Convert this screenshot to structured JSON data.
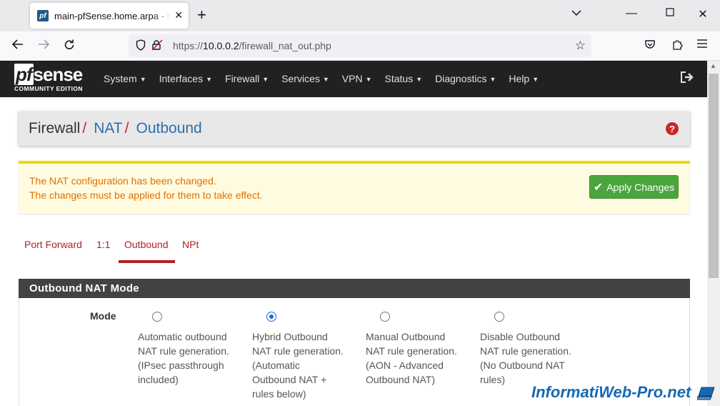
{
  "browser": {
    "tab_title": "main-pfSense.home.arpa - Fire",
    "favicon_text": "pf",
    "url_prefix": "https://",
    "url_host": "10.0.0.2",
    "url_path": "/firewall_nat_out.php"
  },
  "pfsense": {
    "logo_main_pf": "pf",
    "logo_main_rest": "sense",
    "logo_sub": "COMMUNITY EDITION",
    "menu": [
      "System",
      "Interfaces",
      "Firewall",
      "Services",
      "VPN",
      "Status",
      "Diagnostics",
      "Help"
    ]
  },
  "breadcrumb": {
    "root": "Firewall",
    "sep": "/",
    "level1": "NAT",
    "level2": "Outbound"
  },
  "help_icon_glyph": "?",
  "alert": {
    "line1": "The NAT configuration has been changed.",
    "line2": "The changes must be applied for them to take effect.",
    "apply_label": "Apply Changes"
  },
  "subtabs": [
    "Port Forward",
    "1:1",
    "Outbound",
    "NPt"
  ],
  "active_subtab": "Outbound",
  "section": {
    "title": "Outbound NAT Mode",
    "mode_label": "Mode",
    "options": [
      {
        "lines": [
          "Automatic outbound",
          "NAT rule generation.",
          "(IPsec passthrough",
          "included)"
        ],
        "checked": false
      },
      {
        "lines": [
          "Hybrid Outbound",
          "NAT rule generation.",
          "(Automatic",
          "Outbound NAT +",
          "rules below)"
        ],
        "checked": true
      },
      {
        "lines": [
          "Manual Outbound",
          "NAT rule generation.",
          "(AON - Advanced",
          "Outbound NAT)"
        ],
        "checked": false
      },
      {
        "lines": [
          "Disable Outbound",
          "NAT rule generation.",
          "(No Outbound NAT",
          "rules)"
        ],
        "checked": false
      }
    ]
  },
  "watermark": "InformatiWeb-Pro.net",
  "colors": {
    "header_bg": "#212121",
    "accent_red": "#b21f24",
    "link_blue": "#2a6fb0",
    "alert_bg": "#fffbe0",
    "alert_border": "#f2d600",
    "alert_text": "#e07000",
    "apply_green": "#4aa53c",
    "section_head_bg": "#424242",
    "radio_checked": "#0f6dd3"
  }
}
